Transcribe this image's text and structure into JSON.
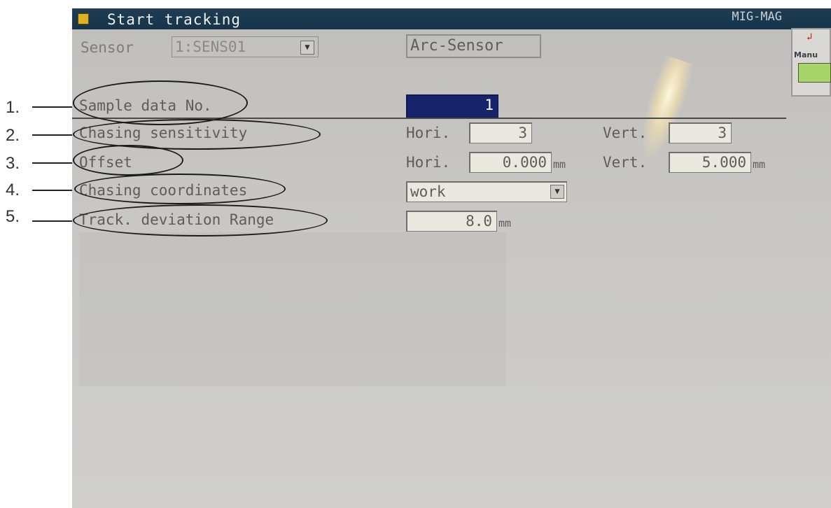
{
  "annotations": [
    "1.",
    "2.",
    "3.",
    "4.",
    "5."
  ],
  "window": {
    "title": "Start tracking",
    "mode": "MIG-MAG",
    "side_button_label": "Manu"
  },
  "sensor": {
    "label": "Sensor",
    "value": "1:SENS01",
    "type": "Arc-Sensor"
  },
  "rows": {
    "sample": {
      "label": "Sample data No.",
      "value": "1"
    },
    "sensitivity": {
      "label": "Chasing sensitivity",
      "hori_label": "Hori.",
      "hori_value": "3",
      "vert_label": "Vert.",
      "vert_value": "3"
    },
    "offset": {
      "label": "Offset",
      "hori_label": "Hori.",
      "hori_value": "0.000",
      "hori_unit": "mm",
      "vert_label": "Vert.",
      "vert_value": "5.000",
      "vert_unit": "mm"
    },
    "coords": {
      "label": "Chasing coordinates",
      "value": "work"
    },
    "deviation": {
      "label": "Track. deviation Range",
      "value": "8.0",
      "unit": "mm"
    }
  },
  "colors": {
    "titlebar": "#16344a",
    "selected_field": "#16246b",
    "screen": "#c9c8c5"
  }
}
